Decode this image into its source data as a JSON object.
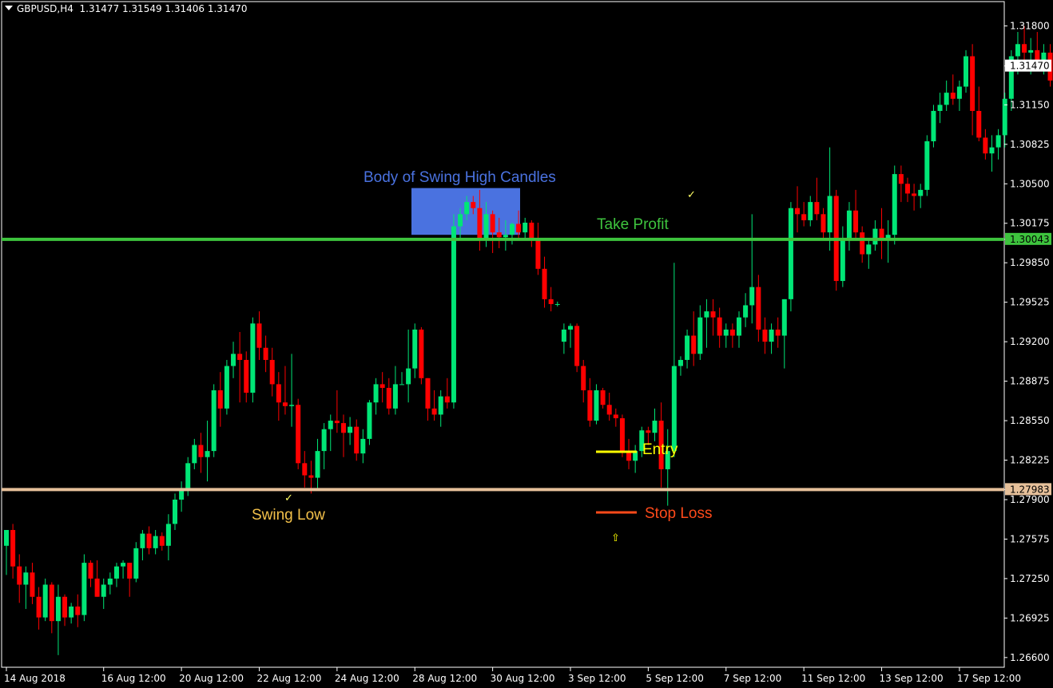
{
  "header": {
    "symbol_timeframe": "GBPUSD,H4",
    "ohlc": "1.31477 1.31549 1.31406 1.31470"
  },
  "colors": {
    "bull": "#00e676",
    "bear": "#ff0000",
    "grid": "#333333",
    "take_profit_line": "#3ec43e",
    "swing_low_line": "#e6c09a",
    "swing_zone": "#4a72e0",
    "entry": "#ffff00",
    "stop_loss": "#ff4a1a",
    "swing_low_text": "#f2c04a"
  },
  "annotations": {
    "swing_zone_label": "Body of Swing High Candles",
    "take_profit_label": "Take Profit",
    "swing_low_label": "Swing Low",
    "entry_label": "Entry",
    "stop_loss_label": "Stop Loss",
    "checkmark": "✓",
    "arrow_up": "⇧"
  },
  "chart_data": {
    "type": "candlestick",
    "symbol": "GBPUSD",
    "timeframe": "H4",
    "ylim": [
      1.2652,
      1.32
    ],
    "y_ticks": [
      "1.31800",
      "1.31470",
      "1.31150",
      "1.30825",
      "1.30500",
      "1.30175",
      "1.30043",
      "1.29850",
      "1.29525",
      "1.29200",
      "1.28875",
      "1.28550",
      "1.28225",
      "1.27983",
      "1.27900",
      "1.27575",
      "1.27250",
      "1.26925",
      "1.26600"
    ],
    "y_tick_values": [
      1.318,
      1.3147,
      1.3115,
      1.30825,
      1.305,
      1.30175,
      1.30043,
      1.2985,
      1.29525,
      1.292,
      1.28875,
      1.2855,
      1.28225,
      1.27983,
      1.279,
      1.27575,
      1.2725,
      1.26925,
      1.266
    ],
    "highlighted_ticks": {
      "current_price": "1.31470",
      "take_profit": "1.30043",
      "swing_low": "1.27983"
    },
    "x_ticks": [
      {
        "label": "14 Aug 2018",
        "index": 0
      },
      {
        "label": "16 Aug 12:00",
        "index": 15
      },
      {
        "label": "20 Aug 12:00",
        "index": 27
      },
      {
        "label": "22 Aug 12:00",
        "index": 39
      },
      {
        "label": "24 Aug 12:00",
        "index": 51
      },
      {
        "label": "28 Aug 12:00",
        "index": 63
      },
      {
        "label": "30 Aug 12:00",
        "index": 75
      },
      {
        "label": "3 Sep 12:00",
        "index": 87
      },
      {
        "label": "5 Sep 12:00",
        "index": 99
      },
      {
        "label": "7 Sep 12:00",
        "index": 111
      },
      {
        "label": "11 Sep 12:00",
        "index": 123
      },
      {
        "label": "13 Sep 12:00",
        "index": 135
      },
      {
        "label": "17 Sep 12:00",
        "index": 147
      }
    ],
    "levels": {
      "take_profit": 1.30043,
      "swing_low": 1.27983,
      "entry": 1.2828,
      "stop_loss": 1.2802,
      "swing_zone_low": 1.3008,
      "swing_zone_high": 1.30465
    },
    "ohlc": [
      [
        1.2752,
        1.2765,
        1.2728,
        1.2765
      ],
      [
        1.2765,
        1.277,
        1.2725,
        1.2735
      ],
      [
        1.2735,
        1.2745,
        1.2705,
        1.272
      ],
      [
        1.272,
        1.2735,
        1.27,
        1.273
      ],
      [
        1.273,
        1.2738,
        1.2704,
        1.271
      ],
      [
        1.271,
        1.2718,
        1.2683,
        1.2693
      ],
      [
        1.2693,
        1.2725,
        1.269,
        1.272
      ],
      [
        1.272,
        1.2722,
        1.268,
        1.269
      ],
      [
        1.269,
        1.272,
        1.2662,
        1.271
      ],
      [
        1.271,
        1.2712,
        1.2686,
        1.2693
      ],
      [
        1.2693,
        1.2705,
        1.2688,
        1.2702
      ],
      [
        1.2702,
        1.2712,
        1.2685,
        1.2695
      ],
      [
        1.2695,
        1.2745,
        1.269,
        1.2738
      ],
      [
        1.2738,
        1.274,
        1.2718,
        1.2725
      ],
      [
        1.2725,
        1.274,
        1.271,
        1.271
      ],
      [
        1.271,
        1.2725,
        1.27,
        1.272
      ],
      [
        1.272,
        1.273,
        1.2712,
        1.2725
      ],
      [
        1.2725,
        1.2738,
        1.2718,
        1.2735
      ],
      [
        1.2735,
        1.274,
        1.2725,
        1.2738
      ],
      [
        1.2738,
        1.2738,
        1.271,
        1.2725
      ],
      [
        1.2725,
        1.2755,
        1.2722,
        1.275
      ],
      [
        1.275,
        1.2765,
        1.274,
        1.2762
      ],
      [
        1.2762,
        1.2768,
        1.2745,
        1.275
      ],
      [
        1.275,
        1.2765,
        1.2745,
        1.276
      ],
      [
        1.276,
        1.2763,
        1.2748,
        1.2752
      ],
      [
        1.2752,
        1.2778,
        1.274,
        1.277
      ],
      [
        1.277,
        1.2795,
        1.2765,
        1.279
      ],
      [
        1.279,
        1.2805,
        1.278,
        1.2798
      ],
      [
        1.2798,
        1.2825,
        1.2793,
        1.282
      ],
      [
        1.282,
        1.284,
        1.2815,
        1.2835
      ],
      [
        1.2835,
        1.2845,
        1.2812,
        1.2825
      ],
      [
        1.2825,
        1.2855,
        1.2805,
        1.283
      ],
      [
        1.283,
        1.2885,
        1.2825,
        1.288
      ],
      [
        1.288,
        1.2895,
        1.285,
        1.2865
      ],
      [
        1.2865,
        1.2905,
        1.286,
        1.29
      ],
      [
        1.29,
        1.292,
        1.289,
        1.291
      ],
      [
        1.291,
        1.2928,
        1.287,
        1.2905
      ],
      [
        1.2905,
        1.2912,
        1.287,
        1.2878
      ],
      [
        1.2878,
        1.294,
        1.287,
        1.2935
      ],
      [
        1.2935,
        1.2945,
        1.2905,
        1.2915
      ],
      [
        1.2915,
        1.2925,
        1.2895,
        1.2905
      ],
      [
        1.2905,
        1.2915,
        1.2875,
        1.2885
      ],
      [
        1.2885,
        1.2895,
        1.2855,
        1.287
      ],
      [
        1.287,
        1.29,
        1.286,
        1.2867
      ],
      [
        1.2867,
        1.291,
        1.285,
        1.2868
      ],
      [
        1.2868,
        1.2873,
        1.2815,
        1.282
      ],
      [
        1.282,
        1.283,
        1.28,
        1.281
      ],
      [
        1.281,
        1.2822,
        1.2795,
        1.2808
      ],
      [
        1.2808,
        1.284,
        1.2798,
        1.283
      ],
      [
        1.283,
        1.2853,
        1.2815,
        1.2848
      ],
      [
        1.2848,
        1.286,
        1.283,
        1.2855
      ],
      [
        1.2855,
        1.288,
        1.2845,
        1.2853
      ],
      [
        1.2853,
        1.286,
        1.2825,
        1.2845
      ],
      [
        1.2845,
        1.2858,
        1.2835,
        1.285
      ],
      [
        1.285,
        1.2856,
        1.2822,
        1.2828
      ],
      [
        1.2828,
        1.2848,
        1.282,
        1.284
      ],
      [
        1.284,
        1.2872,
        1.2835,
        1.287
      ],
      [
        1.287,
        1.289,
        1.286,
        1.2885
      ],
      [
        1.2885,
        1.2895,
        1.287,
        1.2882
      ],
      [
        1.2882,
        1.289,
        1.286,
        1.2865
      ],
      [
        1.2865,
        1.29,
        1.286,
        1.2885
      ],
      [
        1.2885,
        1.2895,
        1.2885,
        1.2885
      ],
      [
        1.2885,
        1.293,
        1.287,
        1.2898
      ],
      [
        1.2898,
        1.2935,
        1.289,
        1.293
      ],
      [
        1.293,
        1.2932,
        1.2885,
        1.289
      ],
      [
        1.289,
        1.289,
        1.2855,
        1.2865
      ],
      [
        1.2865,
        1.288,
        1.2855,
        1.286
      ],
      [
        1.286,
        1.288,
        1.285,
        1.2875
      ],
      [
        1.2875,
        1.289,
        1.2865,
        1.287
      ],
      [
        1.287,
        1.3025,
        1.2865,
        1.3015
      ],
      [
        1.3015,
        1.303,
        1.3005,
        1.3025
      ],
      [
        1.3025,
        1.304,
        1.302,
        1.3035
      ],
      [
        1.3035,
        1.304,
        1.3025,
        1.303
      ],
      [
        1.303,
        1.3045,
        1.2995,
        1.3005
      ],
      [
        1.3005,
        1.3035,
        1.2998,
        1.3025
      ],
      [
        1.3025,
        1.3028,
        1.2993,
        1.301
      ],
      [
        1.301,
        1.3022,
        1.2997,
        1.3006
      ],
      [
        1.3006,
        1.302,
        1.2995,
        1.3008
      ],
      [
        1.3008,
        1.3018,
        1.3,
        1.3017
      ],
      [
        1.3017,
        1.3028,
        1.3005,
        1.301
      ],
      [
        1.301,
        1.3022,
        1.3004,
        1.3018
      ],
      [
        1.3018,
        1.302,
        1.2998,
        1.3004
      ],
      [
        1.3004,
        1.3018,
        1.2975,
        1.298
      ],
      [
        1.298,
        1.299,
        1.2948,
        1.2955
      ],
      [
        1.2955,
        1.2965,
        1.2945,
        1.2951
      ],
      [
        1.2951,
        1.2953,
        1.2949,
        1.2951
      ],
      [
        1.292,
        1.2935,
        1.291,
        1.293
      ],
      [
        1.293,
        1.2935,
        1.2915,
        1.2933
      ],
      [
        1.2933,
        1.2935,
        1.2895,
        1.29
      ],
      [
        1.29,
        1.2905,
        1.287,
        1.288
      ],
      [
        1.288,
        1.289,
        1.285,
        1.2855
      ],
      [
        1.2855,
        1.2885,
        1.2852,
        1.288
      ],
      [
        1.288,
        1.2882,
        1.2865,
        1.2868
      ],
      [
        1.2868,
        1.2878,
        1.2855,
        1.286
      ],
      [
        1.286,
        1.2865,
        1.285,
        1.2857
      ],
      [
        1.2857,
        1.286,
        1.2825,
        1.283
      ],
      [
        1.283,
        1.284,
        1.2815,
        1.2822
      ],
      [
        1.2822,
        1.2835,
        1.2812,
        1.283
      ],
      [
        1.283,
        1.285,
        1.2825,
        1.2847
      ],
      [
        1.2847,
        1.285,
        1.2835,
        1.2845
      ],
      [
        1.2845,
        1.2865,
        1.2838,
        1.2855
      ],
      [
        1.2855,
        1.287,
        1.28,
        1.2815
      ],
      [
        1.2815,
        1.2848,
        1.2785,
        1.283
      ],
      [
        1.283,
        1.2985,
        1.2825,
        1.29
      ],
      [
        1.29,
        1.2908,
        1.2892,
        1.2905
      ],
      [
        1.2905,
        1.293,
        1.2898,
        1.2925
      ],
      [
        1.2925,
        1.2945,
        1.29,
        1.291
      ],
      [
        1.291,
        1.295,
        1.2905,
        1.294
      ],
      [
        1.294,
        1.2955,
        1.2915,
        1.2945
      ],
      [
        1.2945,
        1.2955,
        1.2925,
        1.294
      ],
      [
        1.294,
        1.2948,
        1.2915,
        1.2925
      ],
      [
        1.2925,
        1.2935,
        1.2915,
        1.293
      ],
      [
        1.293,
        1.2935,
        1.2915,
        1.2925
      ],
      [
        1.2925,
        1.2945,
        1.2915,
        1.294
      ],
      [
        1.294,
        1.296,
        1.2932,
        1.295
      ],
      [
        1.295,
        1.3025,
        1.2935,
        1.2965
      ],
      [
        1.2965,
        1.2975,
        1.292,
        1.293
      ],
      [
        1.293,
        1.294,
        1.291,
        1.292
      ],
      [
        1.292,
        1.2935,
        1.291,
        1.293
      ],
      [
        1.293,
        1.294,
        1.2915,
        1.2925
      ],
      [
        1.2925,
        1.2955,
        1.2898,
        1.2955
      ],
      [
        1.2955,
        1.3035,
        1.2945,
        1.303
      ],
      [
        1.303,
        1.3048,
        1.301,
        1.3025
      ],
      [
        1.3025,
        1.3035,
        1.3015,
        1.302
      ],
      [
        1.302,
        1.304,
        1.3015,
        1.3035
      ],
      [
        1.3035,
        1.3055,
        1.302,
        1.3025
      ],
      [
        1.3025,
        1.303,
        1.3005,
        1.301
      ],
      [
        1.301,
        1.308,
        1.2995,
        1.304
      ],
      [
        1.304,
        1.3045,
        1.2962,
        1.297
      ],
      [
        1.297,
        1.3015,
        1.2965,
        1.3005
      ],
      [
        1.3005,
        1.3035,
        1.2995,
        1.3028
      ],
      [
        1.3028,
        1.3045,
        1.3005,
        1.301
      ],
      [
        1.301,
        1.3015,
        1.2985,
        1.2992
      ],
      [
        1.2992,
        1.3005,
        1.298,
        1.3
      ],
      [
        1.3,
        1.302,
        1.2995,
        1.3013
      ],
      [
        1.3013,
        1.303,
        1.2988,
        1.3005
      ],
      [
        1.3005,
        1.302,
        1.2985,
        1.3008
      ],
      [
        1.3008,
        1.3065,
        1.3,
        1.3058
      ],
      [
        1.3058,
        1.3065,
        1.3035,
        1.305
      ],
      [
        1.305,
        1.3055,
        1.3035,
        1.3042
      ],
      [
        1.3042,
        1.305,
        1.3028,
        1.304
      ],
      [
        1.304,
        1.305,
        1.303,
        1.3045
      ],
      [
        1.3045,
        1.309,
        1.304,
        1.3085
      ],
      [
        1.3085,
        1.3115,
        1.308,
        1.311
      ],
      [
        1.311,
        1.3125,
        1.31,
        1.3115
      ],
      [
        1.3115,
        1.3135,
        1.311,
        1.3125
      ],
      [
        1.3125,
        1.314,
        1.3115,
        1.312
      ],
      [
        1.312,
        1.3135,
        1.311,
        1.313
      ],
      [
        1.313,
        1.316,
        1.3125,
        1.3155
      ],
      [
        1.3155,
        1.3165,
        1.309,
        1.311
      ],
      [
        1.311,
        1.313,
        1.3085,
        1.3088
      ],
      [
        1.3088,
        1.3095,
        1.307,
        1.3075
      ],
      [
        1.3075,
        1.309,
        1.306,
        1.308
      ],
      [
        1.308,
        1.3095,
        1.307,
        1.309
      ],
      [
        1.309,
        1.3125,
        1.308,
        1.312
      ],
      [
        1.312,
        1.316,
        1.311,
        1.3155
      ],
      [
        1.3155,
        1.3175,
        1.314,
        1.3165
      ],
      [
        1.3165,
        1.318,
        1.315,
        1.3158
      ],
      [
        1.3158,
        1.317,
        1.314,
        1.316
      ],
      [
        1.316,
        1.3175,
        1.3145,
        1.315
      ],
      [
        1.315,
        1.3165,
        1.314,
        1.3158
      ],
      [
        1.3158,
        1.3165,
        1.313,
        1.3135
      ],
      [
        1.3135,
        1.3165,
        1.3125,
        1.3145
      ],
      [
        1.3145,
        1.316,
        1.3125,
        1.315
      ],
      [
        1.315,
        1.317,
        1.3135,
        1.314
      ],
      [
        1.314,
        1.316,
        1.3135,
        1.315
      ],
      [
        1.315,
        1.3175,
        1.3135,
        1.3147
      ]
    ]
  }
}
